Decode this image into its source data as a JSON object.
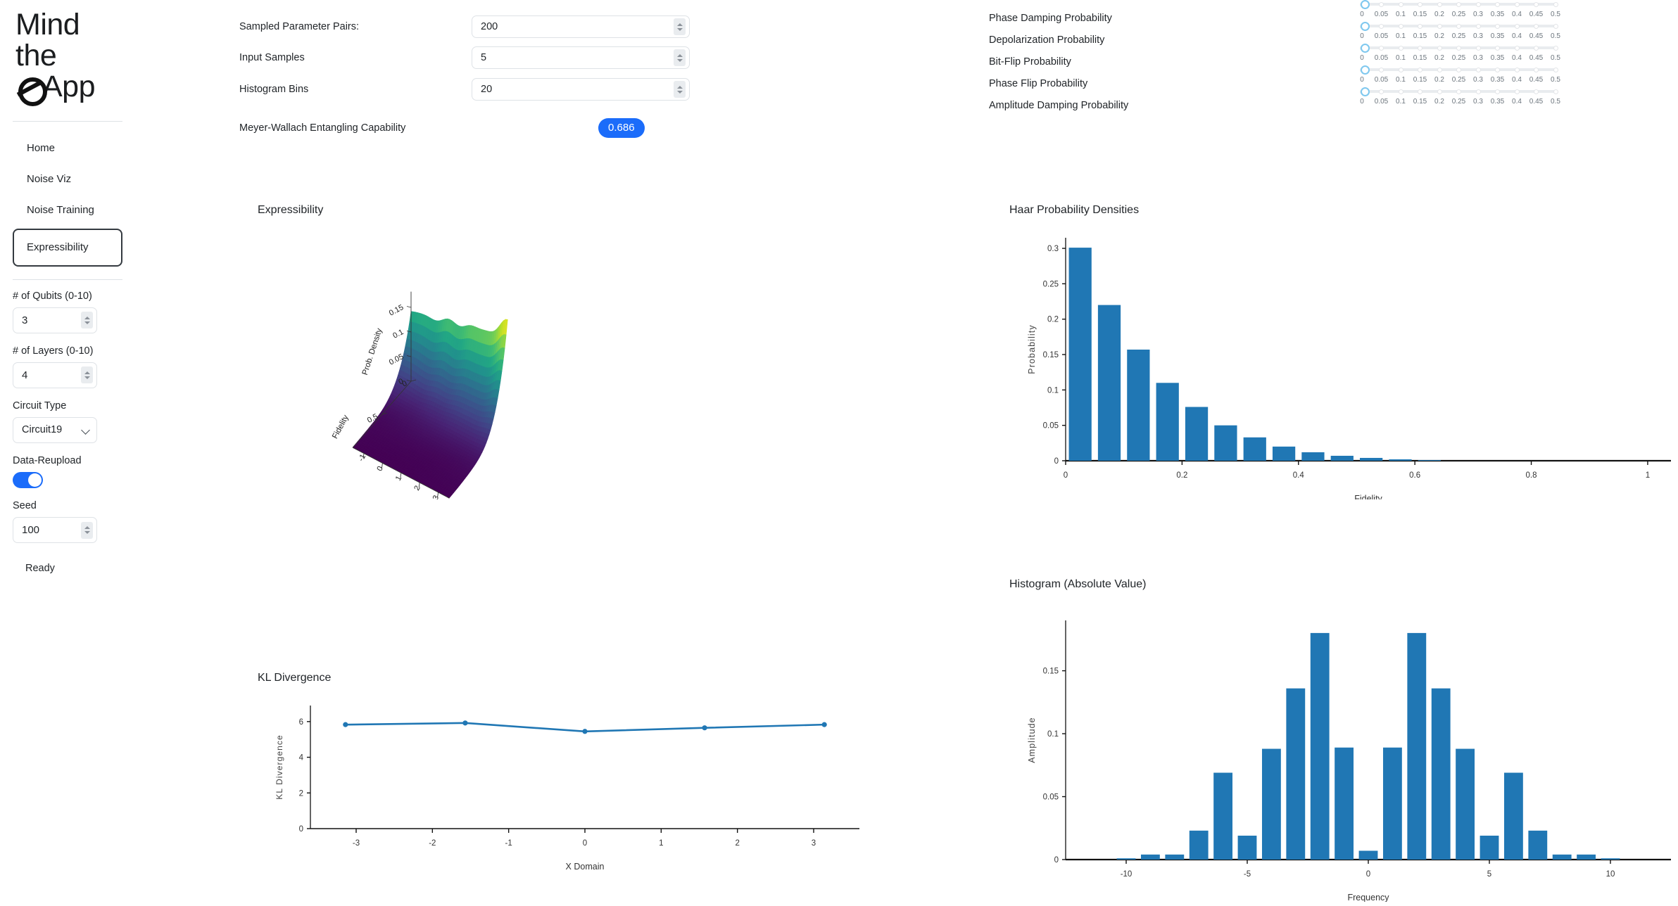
{
  "brand": {
    "line1": "Mind",
    "line2": "the",
    "line3": "App",
    "icon": "q-circle-slash-icon"
  },
  "sidebar": {
    "nav": [
      {
        "label": "Home",
        "active": false
      },
      {
        "label": "Noise Viz",
        "active": false
      },
      {
        "label": "Noise Training",
        "active": false
      },
      {
        "label": "Expressibility",
        "active": true
      }
    ],
    "controls": {
      "qubits_label": "# of Qubits (0-10)",
      "qubits_value": "3",
      "layers_label": "# of Layers (0-10)",
      "layers_value": "4",
      "circuit_type_label": "Circuit Type",
      "circuit_type_value": "Circuit19",
      "data_reupload_label": "Data-Reupload",
      "data_reupload_on": true,
      "seed_label": "Seed",
      "seed_value": "100"
    },
    "status": "Ready"
  },
  "top_form": {
    "rows": [
      {
        "label": "Sampled Parameter Pairs:",
        "value": "200"
      },
      {
        "label": "Input Samples",
        "value": "5"
      },
      {
        "label": "Histogram Bins",
        "value": "20"
      }
    ],
    "metric_label": "Meyer-Wallach Entangling Capability",
    "metric_value": "0.686",
    "metric_color": "#1b6cfa"
  },
  "noise_sliders": {
    "tick_labels": [
      "0",
      "0.05",
      "0.1",
      "0.15",
      "0.2",
      "0.25",
      "0.3",
      "0.35",
      "0.4",
      "0.45",
      "0.5"
    ],
    "min": 0,
    "max": 0.5,
    "items": [
      {
        "label": "Phase Damping Probability",
        "value": 0
      },
      {
        "label": "Depolarization Probability",
        "value": 0
      },
      {
        "label": "Bit-Flip Probability",
        "value": 0
      },
      {
        "label": "Phase Flip Probability",
        "value": 0
      },
      {
        "label": "Amplitude Damping Probability",
        "value": 0
      }
    ]
  },
  "panels": {
    "expressibility_title": "Expressibility",
    "haar_title": "Haar Probability Densities",
    "kl_title": "KL Divergence",
    "histogram_title": "Histogram (Absolute Value)"
  },
  "chart_data": [
    {
      "type": "surface",
      "title": "Expressibility",
      "xlabel": "",
      "ylabel": "Fidelity",
      "zlabel": "Prob. Density",
      "colormap": "viridis",
      "x_ticks": [
        "-1",
        "0",
        "1",
        "2",
        "3"
      ],
      "y_ticks": [
        "0",
        "0.5"
      ],
      "z_ticks": [
        "0",
        "0.05",
        "0.1",
        "0.15"
      ],
      "zlim": [
        0,
        0.175
      ],
      "ylim": [
        0,
        1
      ],
      "description": "3D surface of probability density versus fidelity and x-domain; ridge of high density (yellow-green) at low fidelity falling to purple at high fidelity"
    },
    {
      "type": "bar",
      "title": "Haar Probability Densities",
      "xlabel": "Fidelity",
      "ylabel": "Probability",
      "xlim": [
        0,
        1.04
      ],
      "ylim": [
        0,
        0.315
      ],
      "x_ticks": [
        "0",
        "0.2",
        "0.4",
        "0.6",
        "0.8",
        "1"
      ],
      "y_ticks": [
        "0",
        "0.05",
        "0.1",
        "0.15",
        "0.2",
        "0.25",
        "0.3"
      ],
      "categories": [
        0.0,
        0.05,
        0.1,
        0.15,
        0.2,
        0.25,
        0.3,
        0.35,
        0.4,
        0.45,
        0.5,
        0.55,
        0.6
      ],
      "values": [
        0.301,
        0.22,
        0.157,
        0.11,
        0.076,
        0.05,
        0.033,
        0.02,
        0.012,
        0.007,
        0.004,
        0.002,
        0.001
      ],
      "bar_color": "#2077b4",
      "grid": false
    },
    {
      "type": "line",
      "title": "KL Divergence",
      "xlabel": "X Domain",
      "ylabel": "KL Divergence",
      "xlim": [
        -3.6,
        3.6
      ],
      "ylim": [
        0,
        6.9
      ],
      "x_ticks": [
        "-3",
        "-2",
        "-1",
        "0",
        "1",
        "2",
        "3"
      ],
      "y_ticks": [
        "0",
        "2",
        "4",
        "6"
      ],
      "x": [
        -3.14,
        -1.57,
        0.0,
        1.57,
        3.14
      ],
      "values": [
        5.83,
        5.92,
        5.45,
        5.65,
        5.83
      ],
      "line_color": "#2077b4",
      "grid": false
    },
    {
      "type": "bar",
      "title": "Histogram (Absolute Value)",
      "xlabel": "Frequency",
      "ylabel": "Amplitude",
      "xlim": [
        -12.5,
        12.5
      ],
      "ylim": [
        0,
        0.19
      ],
      "x_ticks": [
        "-10",
        "-5",
        "0",
        "5",
        "10"
      ],
      "y_ticks": [
        "0",
        "0.05",
        "0.1",
        "0.15"
      ],
      "categories": [
        -12,
        -11,
        -10,
        -9,
        -8,
        -7,
        -6,
        -5,
        -4,
        -3,
        -2,
        -1,
        0,
        1,
        2,
        3,
        4,
        5,
        6,
        7,
        8,
        9,
        10
      ],
      "values": [
        0.0,
        0.0,
        0.001,
        0.004,
        0.004,
        0.023,
        0.069,
        0.019,
        0.088,
        0.136,
        0.18,
        0.089,
        0.007,
        0.089,
        0.18,
        0.136,
        0.088,
        0.019,
        0.069,
        0.023,
        0.004,
        0.004,
        0.001
      ],
      "bar_color": "#2077b4",
      "grid": false
    }
  ]
}
